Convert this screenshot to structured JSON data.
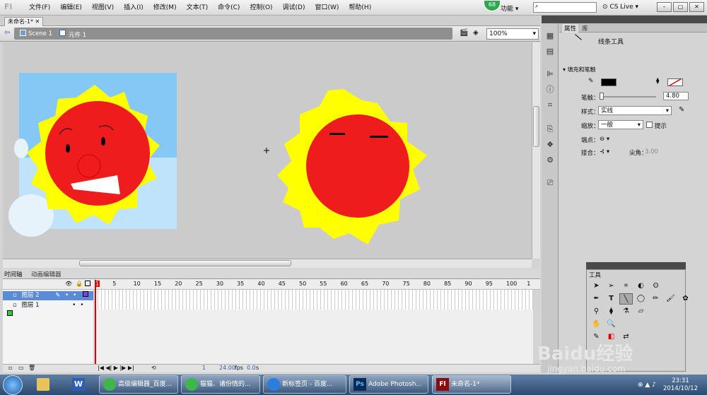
{
  "menubar": {
    "items": [
      "文件(F)",
      "编辑(E)",
      "视图(V)",
      "插入(I)",
      "修改(M)",
      "文本(T)",
      "命令(C)",
      "控制(O)",
      "调试(D)",
      "窗口(W)",
      "帮助(H)"
    ],
    "badge": "68",
    "func_label": "功能",
    "cslive": "CS Live"
  },
  "document": {
    "tab": "未命名-1*",
    "scene": "Scene 1",
    "symbol": "元件 1",
    "zoom": "100%"
  },
  "timeline": {
    "tab_timeline": "时间轴",
    "tab_motion": "动画编辑器",
    "ruler": [
      "1",
      "5",
      "10",
      "15",
      "20",
      "25",
      "30",
      "35",
      "40",
      "45",
      "50",
      "55",
      "60",
      "65",
      "70",
      "75",
      "80",
      "85",
      "90",
      "95",
      "100",
      "1"
    ],
    "layers": [
      {
        "name": "图层 2",
        "selected": true
      },
      {
        "name": "图层 1",
        "selected": false
      }
    ],
    "footer": {
      "frame": "1",
      "fps": "24.00",
      "fps_unit": "fps",
      "time": "0.0",
      "time_unit": "s"
    }
  },
  "properties": {
    "tab_props": "属性",
    "tab_lib": "库",
    "tool_name": "线条工具",
    "section": "填充和笔触",
    "stroke_label": "笔触：",
    "stroke_value": "4.80",
    "style_label": "样式：",
    "style_value": "实线",
    "scale_label": "缩放：",
    "scale_value": "一般",
    "hint_label": "提示",
    "cap_label": "端点：",
    "join_label": "接合：",
    "miter_label": "尖角：",
    "miter_value": "3.00"
  },
  "tools": {
    "title": "工具"
  },
  "taskbar": {
    "items": [
      "高级编辑器_百度...",
      "猫猫、诸份情的...",
      "新标签页 - 百度...",
      "Adobe Photosh...",
      "未命名-1*"
    ],
    "time": "23:31",
    "date": "2014/10/12"
  },
  "watermark": {
    "brand": "Baidu经验",
    "url": "jingyan.baidu.com"
  }
}
